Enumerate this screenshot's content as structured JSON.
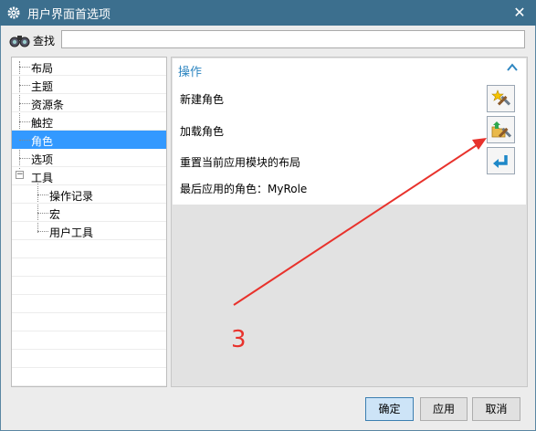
{
  "window": {
    "title": "用户界面首选项"
  },
  "search": {
    "label": "查找",
    "value": "",
    "placeholder": ""
  },
  "tree": {
    "items": [
      {
        "label": "布局"
      },
      {
        "label": "主题"
      },
      {
        "label": "资源条"
      },
      {
        "label": "触控"
      },
      {
        "label": "角色"
      },
      {
        "label": "选项"
      },
      {
        "label": "工具"
      },
      {
        "label": "操作记录"
      },
      {
        "label": "宏"
      },
      {
        "label": "用户工具"
      }
    ],
    "selected": "角色"
  },
  "panel": {
    "header": "操作",
    "new_role": "新建角色",
    "load_role": "加载角色",
    "reset_layout": "重置当前应用模块的布局",
    "last_role": "最后应用的角色：MyRole"
  },
  "annotation": {
    "number": "3",
    "color": "#e8322c"
  },
  "footer": {
    "ok": "确定",
    "apply": "应用",
    "cancel": "取消"
  },
  "colors": {
    "titlebar": "#3c6f8e",
    "accent": "#2e86c1",
    "selection": "#3399ff"
  }
}
